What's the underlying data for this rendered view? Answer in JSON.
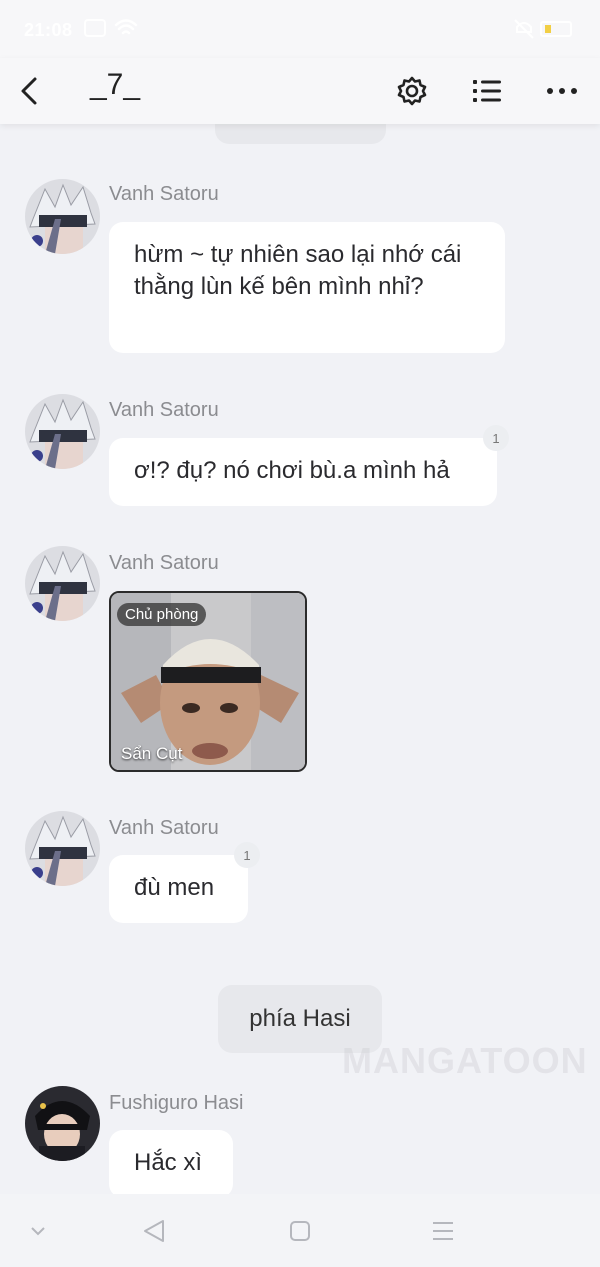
{
  "status_bar": {
    "time": "21:08",
    "icons": [
      "notification-icon",
      "wifi-icon",
      "mute-icon",
      "battery-icon"
    ]
  },
  "header": {
    "title": "_7_",
    "icons": [
      "back-icon",
      "gear-icon",
      "list-icon",
      "more-icon"
    ]
  },
  "messages": [
    {
      "sender": "Vanh Satoru",
      "text": "hừm ~ tự nhiên sao lại nhớ cái thằng lùn kế bên mình nhỉ?"
    },
    {
      "sender": "Vanh Satoru",
      "text": "ơ!? đụ? nó chơi bù.a mình hả",
      "read_count": "1"
    },
    {
      "sender": "Vanh Satoru",
      "image": {
        "tag": "Chủ phòng",
        "caption": "Sẩn Cụt"
      }
    },
    {
      "sender": "Vanh Satoru",
      "text": "đù men",
      "read_count": "1"
    },
    {
      "system": "phía Hasi"
    },
    {
      "sender": "Fushiguro Hasi",
      "text": "Hắc xì"
    }
  ],
  "watermark": "MANGATOON",
  "colors": {
    "background": "#f1f2f6",
    "bubble": "#ffffff",
    "system_bubble": "#e7e8ec",
    "sender_name": "#8b8c90"
  },
  "nav": {
    "icons": [
      "chevron-down-icon",
      "nav-back-icon",
      "nav-home-icon",
      "nav-menu-icon"
    ]
  }
}
